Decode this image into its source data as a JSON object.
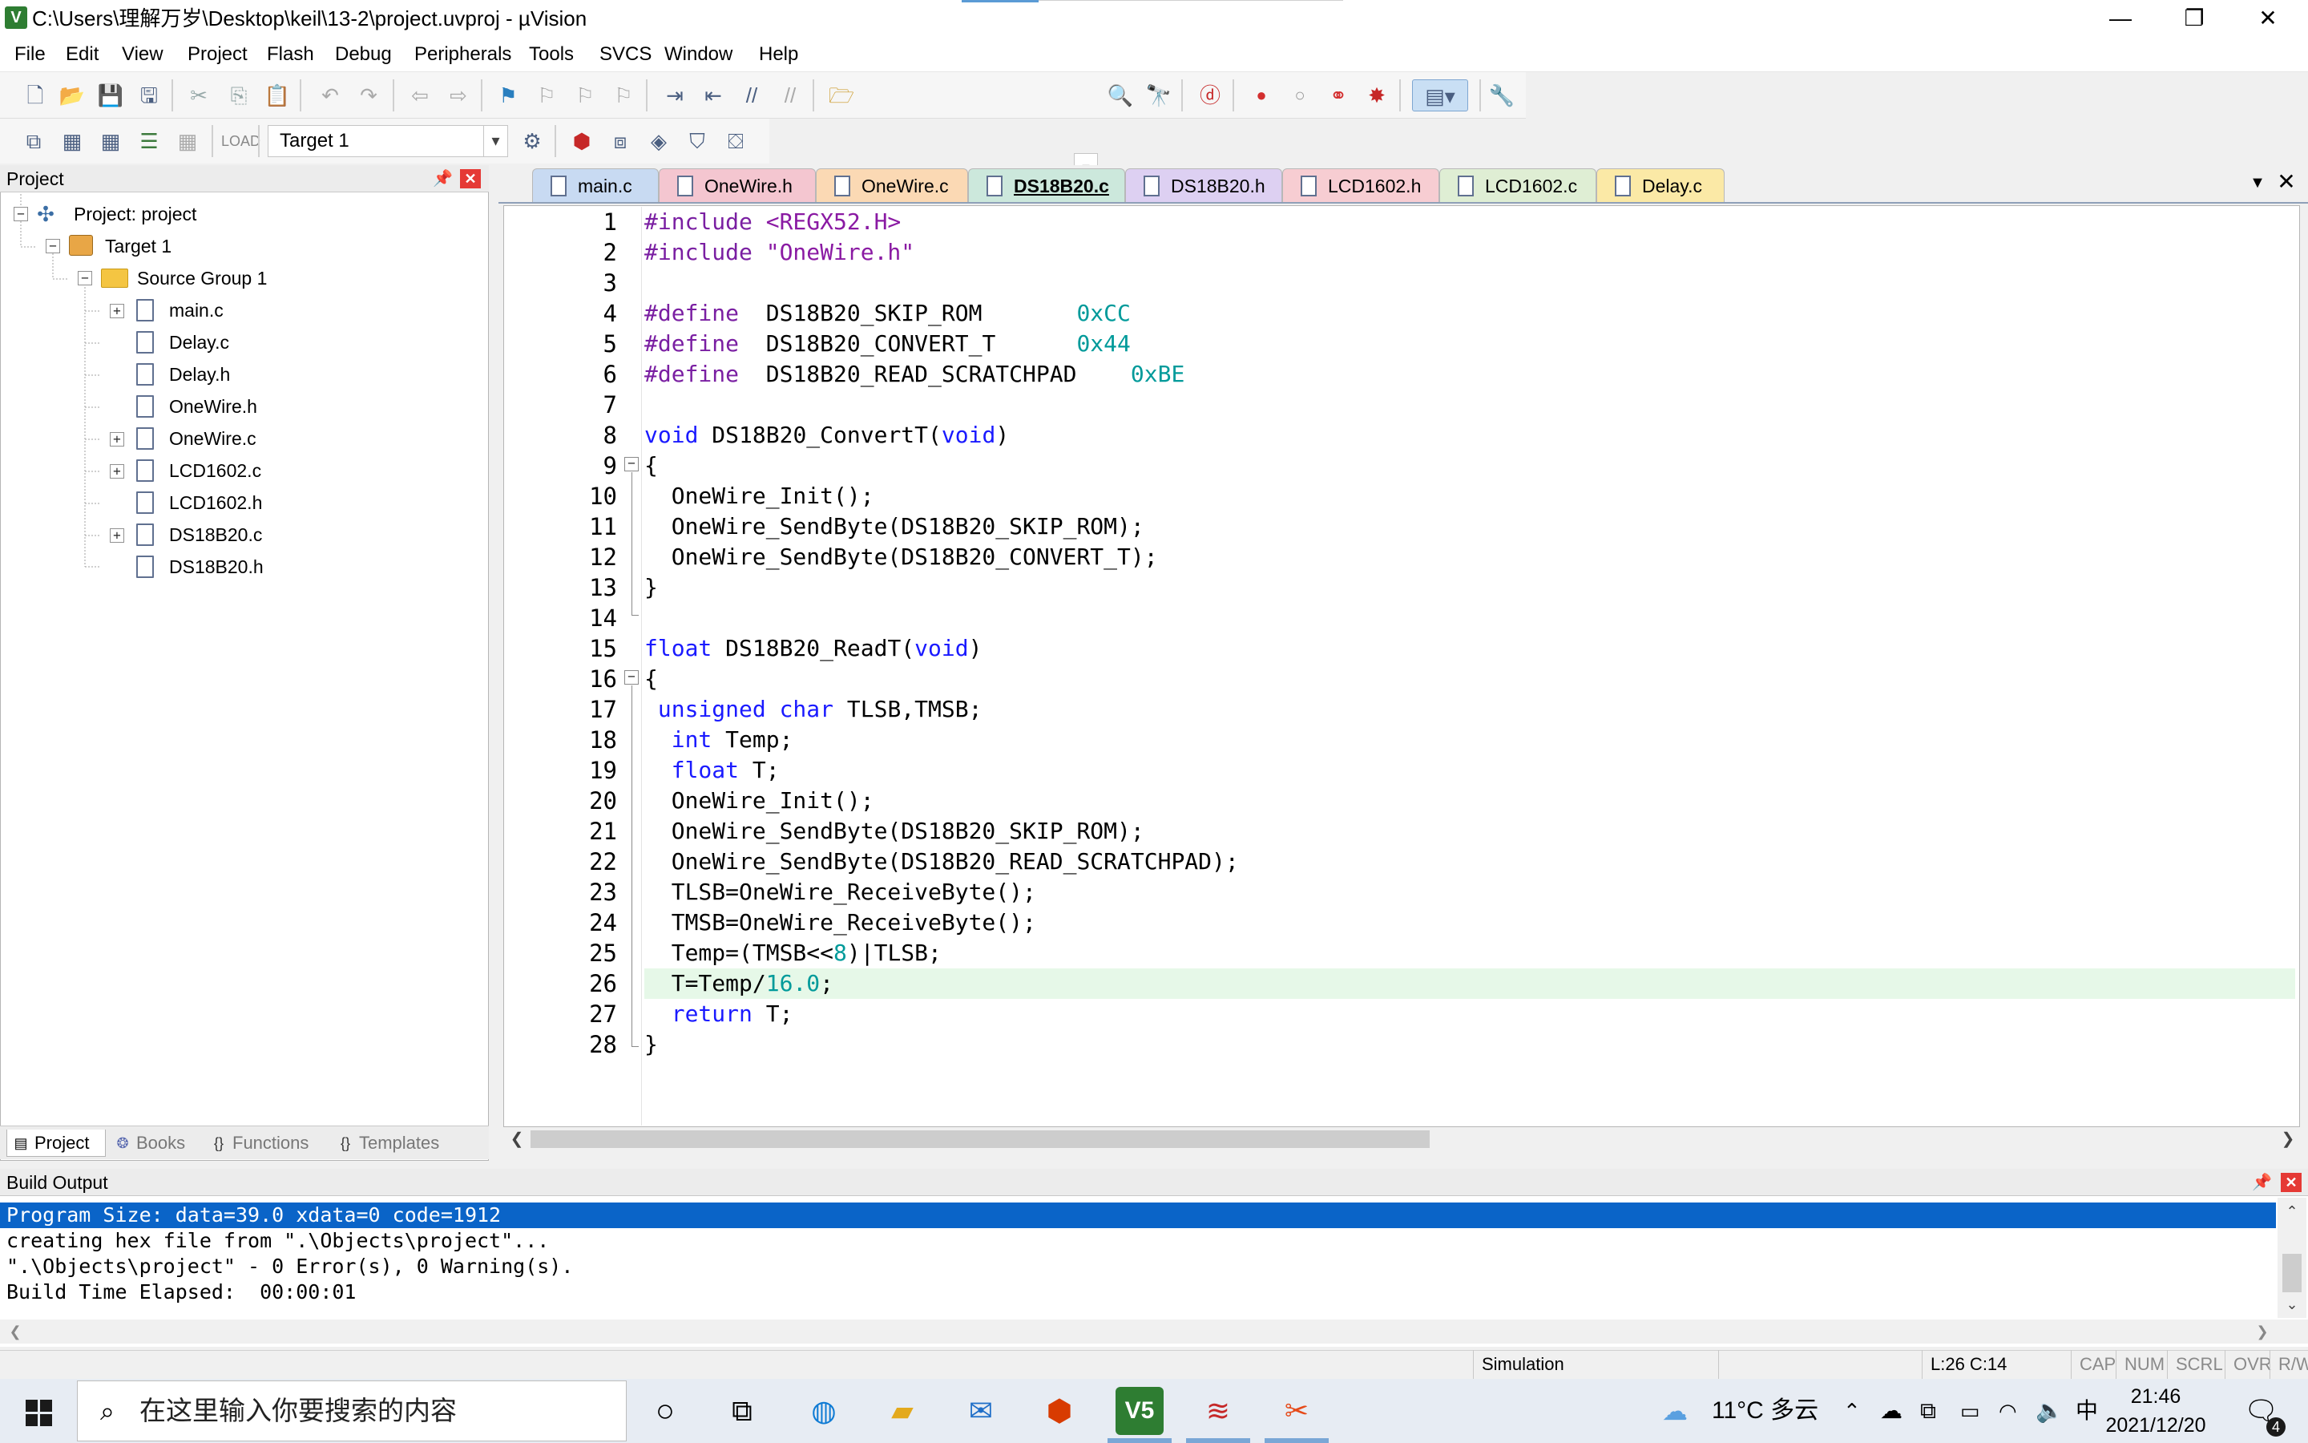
{
  "window": {
    "title": "C:\\Users\\理解万岁\\Desktop\\keil\\13-2\\project.uvproj - µVision",
    "min_glyph": "—",
    "max_glyph": "❐",
    "close_glyph": "✕"
  },
  "menu": [
    "File",
    "Edit",
    "View",
    "Project",
    "Flash",
    "Debug",
    "Peripherals",
    "Tools",
    "SVCS",
    "Window",
    "Help"
  ],
  "toolbar2": {
    "target": "Target 1"
  },
  "project_panel": {
    "title": "Project",
    "tree": {
      "root": "Project: project",
      "target": "Target 1",
      "group": "Source Group 1",
      "files": [
        "main.c",
        "Delay.c",
        "Delay.h",
        "OneWire.h",
        "OneWire.c",
        "LCD1602.c",
        "LCD1602.h",
        "DS18B20.c",
        "DS18B20.h"
      ]
    },
    "tabs": [
      "Project",
      "Books",
      "Functions",
      "Templates"
    ]
  },
  "editor": {
    "tabs": [
      {
        "label": "main.c",
        "color": "#c8daf2"
      },
      {
        "label": "OneWire.h",
        "color": "#f4c6d0"
      },
      {
        "label": "OneWire.c",
        "color": "#fbd9b4"
      },
      {
        "label": "DS18B20.c",
        "color": "#cce8dc"
      },
      {
        "label": "DS18B20.h",
        "color": "#ddd0f2"
      },
      {
        "label": "LCD1602.h",
        "color": "#f7cdd2"
      },
      {
        "label": "LCD1602.c",
        "color": "#dfeed4"
      },
      {
        "label": "Delay.c",
        "color": "#fbe9a6"
      }
    ],
    "active_tab": "DS18B20.c",
    "current_line": 26,
    "lines": [
      "1",
      "2",
      "3",
      "4",
      "5",
      "6",
      "7",
      "8",
      "9",
      "10",
      "11",
      "12",
      "13",
      "14",
      "15",
      "16",
      "17",
      "18",
      "19",
      "20",
      "21",
      "22",
      "23",
      "24",
      "25",
      "26",
      "27",
      "28"
    ]
  },
  "build_output": {
    "title": "Build Output",
    "lines": [
      "Program Size: data=39.0 xdata=0 code=1912",
      "creating hex file from \".\\Objects\\project\"...",
      "\".\\Objects\\project\" - 0 Error(s), 0 Warning(s).",
      "Build Time Elapsed:  00:00:01"
    ]
  },
  "status": {
    "mode": "Simulation",
    "position": "L:26 C:14",
    "cap": "CAP",
    "num": "NUM",
    "scrl": "SCRL",
    "ovr": "OVR",
    "rw": "R/W"
  },
  "taskbar": {
    "search_placeholder": "在这里输入你要搜索的内容",
    "weather": "11°C 多云",
    "ime": "中",
    "time": "21:46",
    "date": "2021/12/20",
    "notifications": "4"
  }
}
